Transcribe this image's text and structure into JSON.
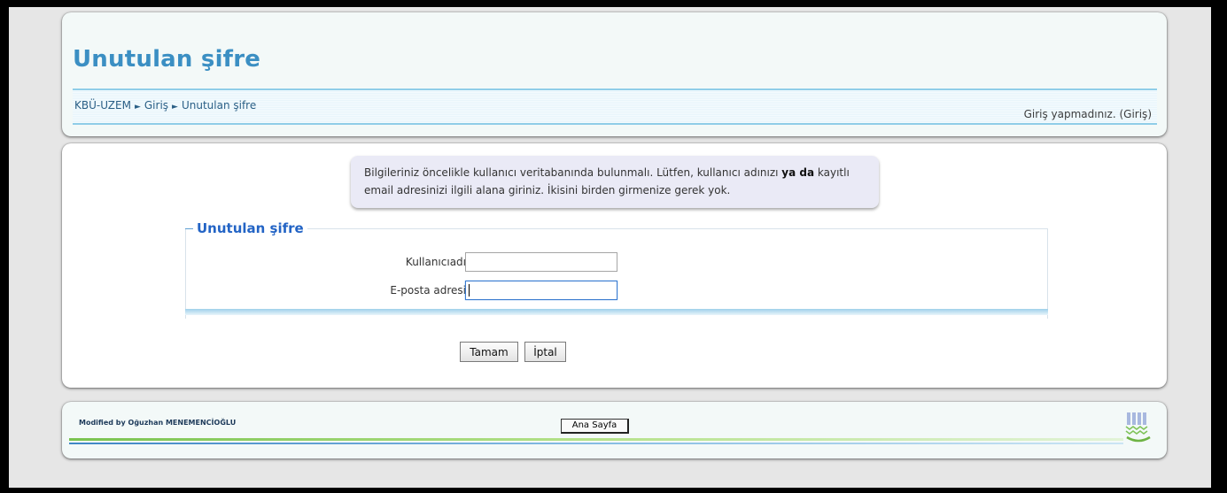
{
  "header": {
    "title": "Unutulan şifre",
    "breadcrumb": [
      "KBÜ-UZEM",
      "Giriş",
      "Unutulan şifre"
    ],
    "breadcrumb_separator": "►",
    "login_text": "Giriş yapmadınız. (Giriş)"
  },
  "notice": {
    "text_before": "Bilgileriniz öncelikle kullanıcı veritabanında bulunmalı. Lütfen, kullanıcı adınızı ",
    "text_bold": "ya da",
    "text_after": " kayıtlı email adresinizi ilgili alana giriniz. İkisini birden girmenize gerek yok."
  },
  "form": {
    "legend": "Unutulan şifre",
    "username_label": "Kullanıcıadı",
    "username_value": "",
    "email_label": "E-posta adresi",
    "email_value": ""
  },
  "buttons": {
    "ok": "Tamam",
    "cancel": "İptal"
  },
  "footer": {
    "credit": "Modified by Oğuzhan MENEMENCİOĞLU",
    "home_button": "Ana Sayfa"
  },
  "colors": {
    "title": "#3b8fc3",
    "legend": "#2364c5",
    "accent_line": "#8fcde8"
  }
}
